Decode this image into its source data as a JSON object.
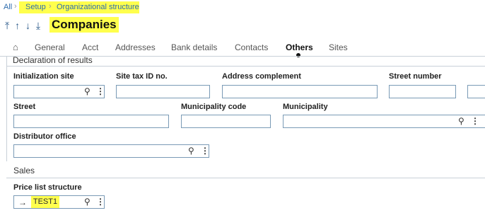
{
  "breadcrumb": {
    "root": "All",
    "items": [
      "Setup",
      "Organizational structure"
    ]
  },
  "header": {
    "arrows": "⤒ ↑ ↓ ⤓",
    "title": "Companies"
  },
  "tabs": [
    {
      "label": "General",
      "active": false
    },
    {
      "label": "Acct",
      "active": false
    },
    {
      "label": "Addresses",
      "active": false
    },
    {
      "label": "Bank details",
      "active": false
    },
    {
      "label": "Contacts",
      "active": false
    },
    {
      "label": "Others",
      "active": true
    },
    {
      "label": "Sites",
      "active": false
    }
  ],
  "sections": {
    "declaration": "Declaration of results",
    "sales": "Sales"
  },
  "fields": {
    "initialization_site": {
      "label": "Initialization site",
      "value": ""
    },
    "site_tax_id": {
      "label": "Site tax ID no.",
      "value": ""
    },
    "address_complement": {
      "label": "Address complement",
      "value": ""
    },
    "street_number": {
      "label": "Street number",
      "value": ""
    },
    "street": {
      "label": "Street",
      "value": ""
    },
    "municipality_code": {
      "label": "Municipality code",
      "value": ""
    },
    "municipality": {
      "label": "Municipality",
      "value": ""
    },
    "distributor_office": {
      "label": "Distributor office",
      "value": ""
    },
    "price_list_structure": {
      "label": "Price list structure",
      "value": "TEST1"
    }
  },
  "icons": {
    "home": "⌂",
    "search": "⚲",
    "more": "⋮",
    "link": "→"
  },
  "colors": {
    "highlight": "#ffff4d",
    "field_border": "#7a9ab6",
    "link": "#2d6cad"
  }
}
